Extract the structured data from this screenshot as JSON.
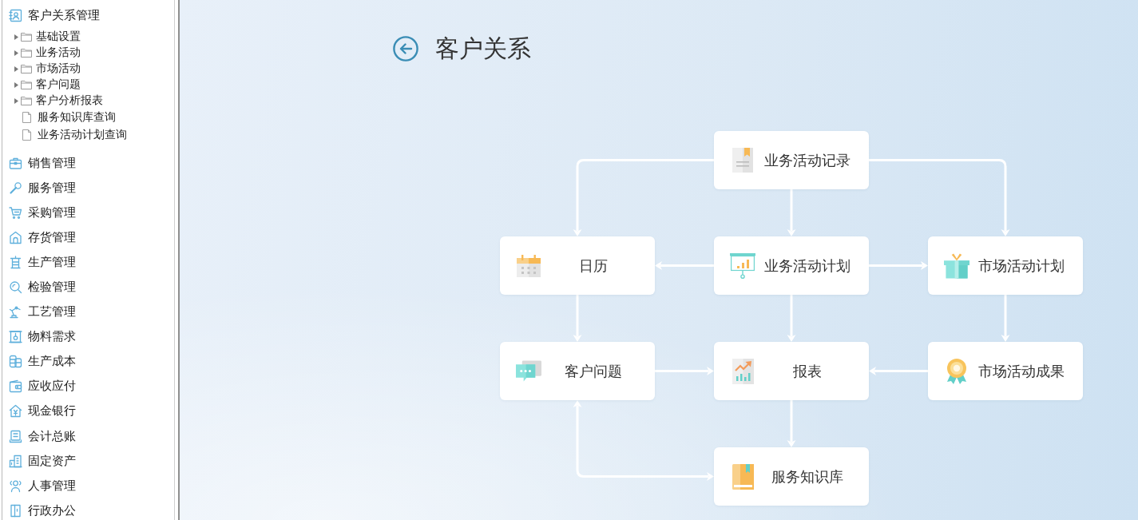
{
  "sidebar": {
    "items": [
      {
        "label": "客户关系管理",
        "children": [
          {
            "kind": "folder",
            "label": "基础设置",
            "expanded": false
          },
          {
            "kind": "folder",
            "label": "业务活动",
            "expanded": false
          },
          {
            "kind": "folder",
            "label": "市场活动",
            "expanded": false
          },
          {
            "kind": "folder",
            "label": "客户问题",
            "expanded": false
          },
          {
            "kind": "folder",
            "label": "客户分析报表",
            "expanded": false
          },
          {
            "kind": "file",
            "label": "服务知识库查询"
          },
          {
            "kind": "file",
            "label": "业务活动计划查询"
          }
        ]
      },
      {
        "label": "销售管理"
      },
      {
        "label": "服务管理"
      },
      {
        "label": "采购管理"
      },
      {
        "label": "存货管理"
      },
      {
        "label": "生产管理"
      },
      {
        "label": "检验管理"
      },
      {
        "label": "工艺管理"
      },
      {
        "label": "物料需求"
      },
      {
        "label": "生产成本"
      },
      {
        "label": "应收应付"
      },
      {
        "label": "现金银行"
      },
      {
        "label": "会计总账"
      },
      {
        "label": "固定资产"
      },
      {
        "label": "人事管理"
      },
      {
        "label": "行政办公"
      }
    ]
  },
  "page": {
    "title": "客户关系"
  },
  "diagram": {
    "nodes": [
      {
        "label": "业务活动记录"
      },
      {
        "label": "日历"
      },
      {
        "label": "业务活动计划"
      },
      {
        "label": "市场活动计划"
      },
      {
        "label": "客户问题"
      },
      {
        "label": "报表"
      },
      {
        "label": "市场活动成果"
      },
      {
        "label": "服务知识库"
      }
    ]
  }
}
